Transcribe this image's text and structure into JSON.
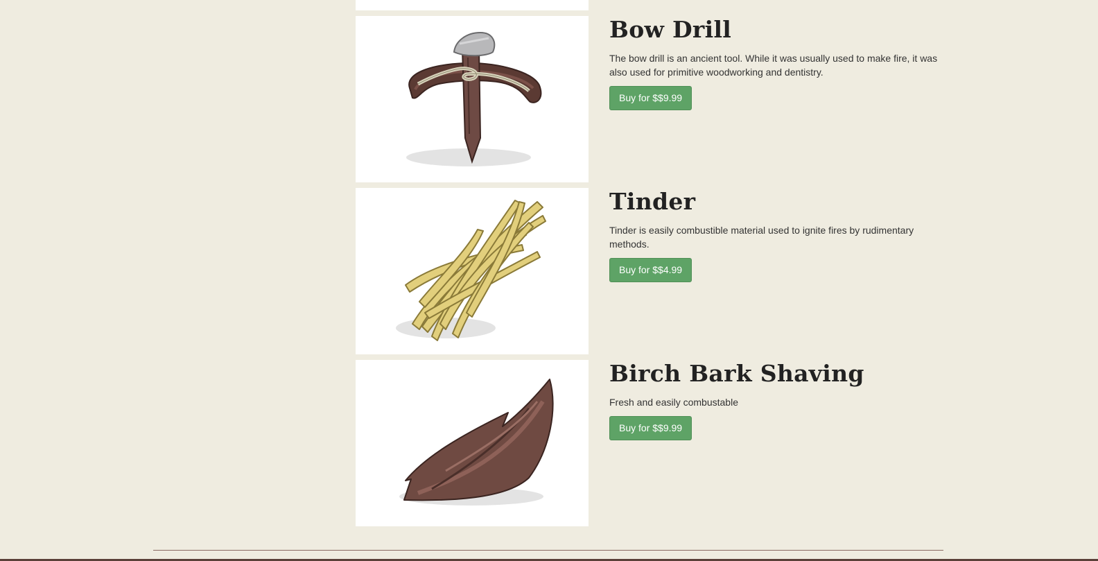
{
  "products": [
    {
      "name": "Bow Drill",
      "description": "The bow drill is an ancient tool. While it was usually used to make fire, it was also used for primitive woodworking and dentistry.",
      "button_label": "Buy for $$9.99",
      "image_icon": "bow-drill-icon"
    },
    {
      "name": "Tinder",
      "description": "Tinder is easily combustible material used to ignite fires by rudimentary methods.",
      "button_label": "Buy for $$4.99",
      "image_icon": "tinder-icon"
    },
    {
      "name": "Birch Bark Shaving",
      "description": "Fresh and easily combustable",
      "button_label": "Buy for $$9.99",
      "image_icon": "birch-bark-icon"
    }
  ],
  "colors": {
    "page_background": "#efece0",
    "button": "#5ea366",
    "footer_rule": "#8a6a62"
  }
}
